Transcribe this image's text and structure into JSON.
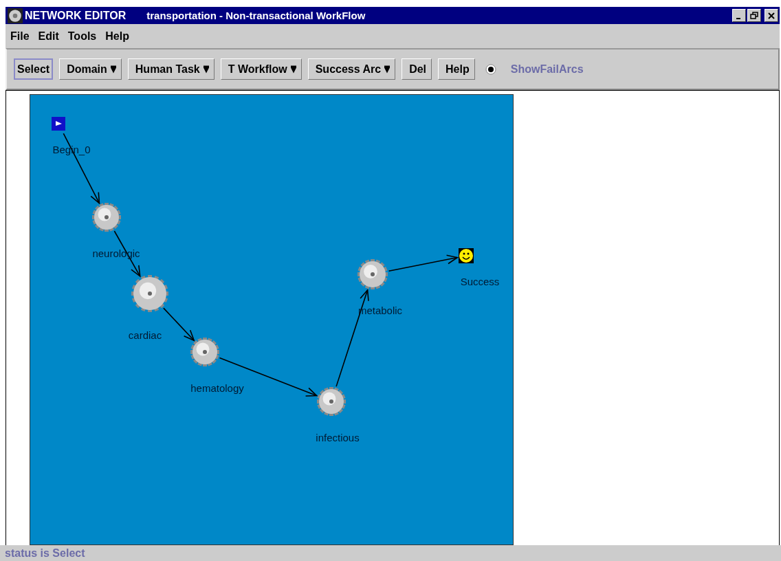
{
  "window": {
    "app_name": "NETWORK EDITOR",
    "title": "transportation - Non-transactional WorkFlow"
  },
  "menu": [
    "File",
    "Edit",
    "Tools",
    "Help"
  ],
  "toolbar": [
    {
      "label": "Select",
      "kind": "button",
      "selected": true
    },
    {
      "label": "Domain",
      "kind": "dropdown",
      "selected": false
    },
    {
      "label": "Human Task",
      "kind": "dropdown",
      "selected": false
    },
    {
      "label": "T Workflow",
      "kind": "dropdown",
      "selected": false
    },
    {
      "label": "Success Arc",
      "kind": "dropdown",
      "selected": false
    },
    {
      "label": "Del",
      "kind": "button",
      "selected": false
    },
    {
      "label": "Help",
      "kind": "button",
      "selected": false
    }
  ],
  "show_fail_arcs": {
    "label": "ShowFailArcs",
    "checked": true
  },
  "workflow": {
    "nodes": [
      {
        "label": "Begin_0",
        "kind": "start"
      },
      {
        "label": "neurologic",
        "kind": "task"
      },
      {
        "label": "cardiac",
        "kind": "task"
      },
      {
        "label": "hematology",
        "kind": "task"
      },
      {
        "label": "infectious",
        "kind": "task"
      },
      {
        "label": "metabolic",
        "kind": "task"
      },
      {
        "label": "Success",
        "kind": "end"
      }
    ]
  },
  "status_bar": "status is Select"
}
